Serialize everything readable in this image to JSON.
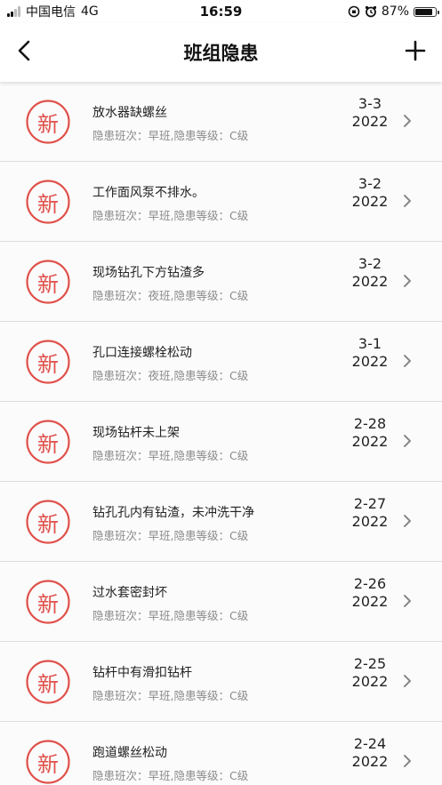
{
  "status_bar": {
    "carrier": "中国电信",
    "network": "4G",
    "time": "16:59",
    "battery_percent": "87%",
    "battery_level": 0.87
  },
  "nav": {
    "title": "班组隐患",
    "back_icon": "chevron-left-icon",
    "add_icon": "plus-icon"
  },
  "colors": {
    "accent": "#e0504a"
  },
  "badge_label": "新",
  "items": [
    {
      "title": "放水器缺螺丝",
      "subtitle": "隐患班次：早班,隐患等级：C级",
      "date": "3-3",
      "year": "2022"
    },
    {
      "title": "工作面风泵不排水。",
      "subtitle": "隐患班次：早班,隐患等级：C级",
      "date": "3-2",
      "year": "2022"
    },
    {
      "title": "现场钻孔下方钻渣多",
      "subtitle": "隐患班次：夜班,隐患等级：C级",
      "date": "3-2",
      "year": "2022"
    },
    {
      "title": "孔口连接螺栓松动",
      "subtitle": "隐患班次：夜班,隐患等级：C级",
      "date": "3-1",
      "year": "2022"
    },
    {
      "title": "现场钻杆未上架",
      "subtitle": "隐患班次：早班,隐患等级：C级",
      "date": "2-28",
      "year": "2022"
    },
    {
      "title": "钻孔孔内有钻渣，未冲洗干净",
      "subtitle": "隐患班次：早班,隐患等级：C级",
      "date": "2-27",
      "year": "2022"
    },
    {
      "title": "过水套密封坏",
      "subtitle": "隐患班次：早班,隐患等级：C级",
      "date": "2-26",
      "year": "2022"
    },
    {
      "title": "钻杆中有滑扣钻杆",
      "subtitle": "隐患班次：早班,隐患等级：C级",
      "date": "2-25",
      "year": "2022"
    },
    {
      "title": "跑道螺丝松动",
      "subtitle": "隐患班次：早班,隐患等级：C级",
      "date": "2-24",
      "year": "2022"
    }
  ]
}
